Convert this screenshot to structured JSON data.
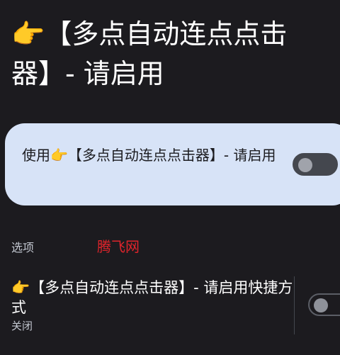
{
  "header": {
    "back_icon": "chevron-left-icon",
    "title": "👉【多点自动连点点击器】- 请启用"
  },
  "main_switch": {
    "label": "使用👉【多点自动连点点击器】- 请启用",
    "state": "off"
  },
  "options_section": {
    "label": "选项"
  },
  "watermark": {
    "text": "腾飞网"
  },
  "shortcut_pref": {
    "title": "👉【多点自动连点点击器】- 请启用快捷方式",
    "summary": "关闭",
    "state": "off"
  },
  "colors": {
    "background": "#1c1b1f",
    "card": "#d7e3f7",
    "watermark": "#e0242b"
  }
}
